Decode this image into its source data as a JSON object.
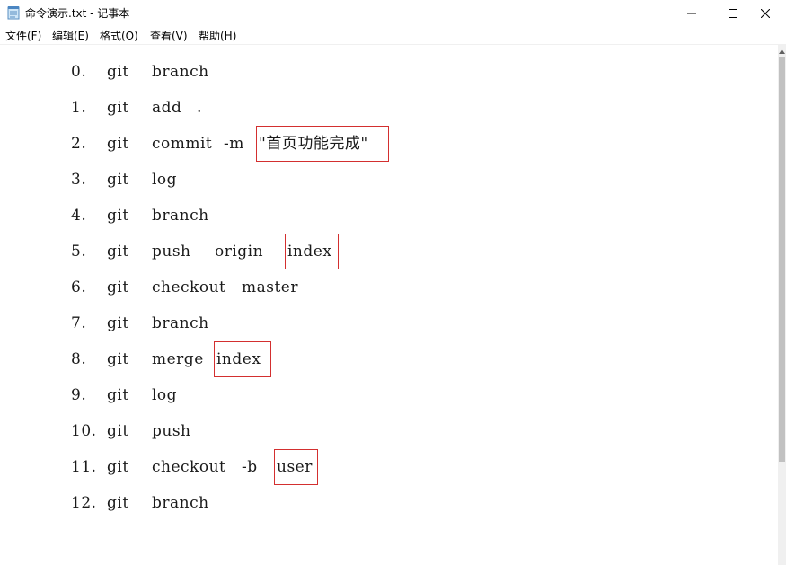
{
  "window": {
    "title": "命令演示.txt - 记事本",
    "buttons": {
      "minimize": "minimize",
      "maximize": "maximize",
      "close": "close"
    }
  },
  "menu": {
    "items": [
      {
        "label": "文件(F)"
      },
      {
        "label": "编辑(E)"
      },
      {
        "label": "格式(O)"
      },
      {
        "label": "查看(V)"
      },
      {
        "label": "帮助(H)"
      }
    ]
  },
  "editor": {
    "lines": [
      {
        "num": "0.",
        "tokens": [
          "git",
          "branch"
        ]
      },
      {
        "num": "1.",
        "tokens": [
          "git",
          "add",
          "."
        ]
      },
      {
        "num": "2.",
        "tokens": [
          "git",
          "commit",
          "-m",
          "\"首页功能完成\""
        ],
        "highlight_index": 3
      },
      {
        "num": "3.",
        "tokens": [
          "git",
          "log"
        ]
      },
      {
        "num": "4.",
        "tokens": [
          "git",
          "branch"
        ]
      },
      {
        "num": "5.",
        "tokens": [
          "git",
          "push",
          "origin",
          "index"
        ],
        "highlight_index": 3
      },
      {
        "num": "6.",
        "tokens": [
          "git",
          "checkout",
          "master"
        ]
      },
      {
        "num": "7.",
        "tokens": [
          "git",
          "branch"
        ]
      },
      {
        "num": "8.",
        "tokens": [
          "git",
          "merge",
          "index"
        ],
        "highlight_index": 2
      },
      {
        "num": "9.",
        "tokens": [
          "git",
          "log"
        ]
      },
      {
        "num": "10.",
        "tokens": [
          "git",
          "push"
        ]
      },
      {
        "num": "11.",
        "tokens": [
          "git",
          "checkout",
          "-b",
          "user"
        ],
        "highlight_index": 3
      },
      {
        "num": "12.",
        "tokens": [
          "git",
          "branch"
        ]
      }
    ]
  },
  "colors": {
    "highlight_border": "#d32f2f",
    "text": "#1a1a1a"
  }
}
